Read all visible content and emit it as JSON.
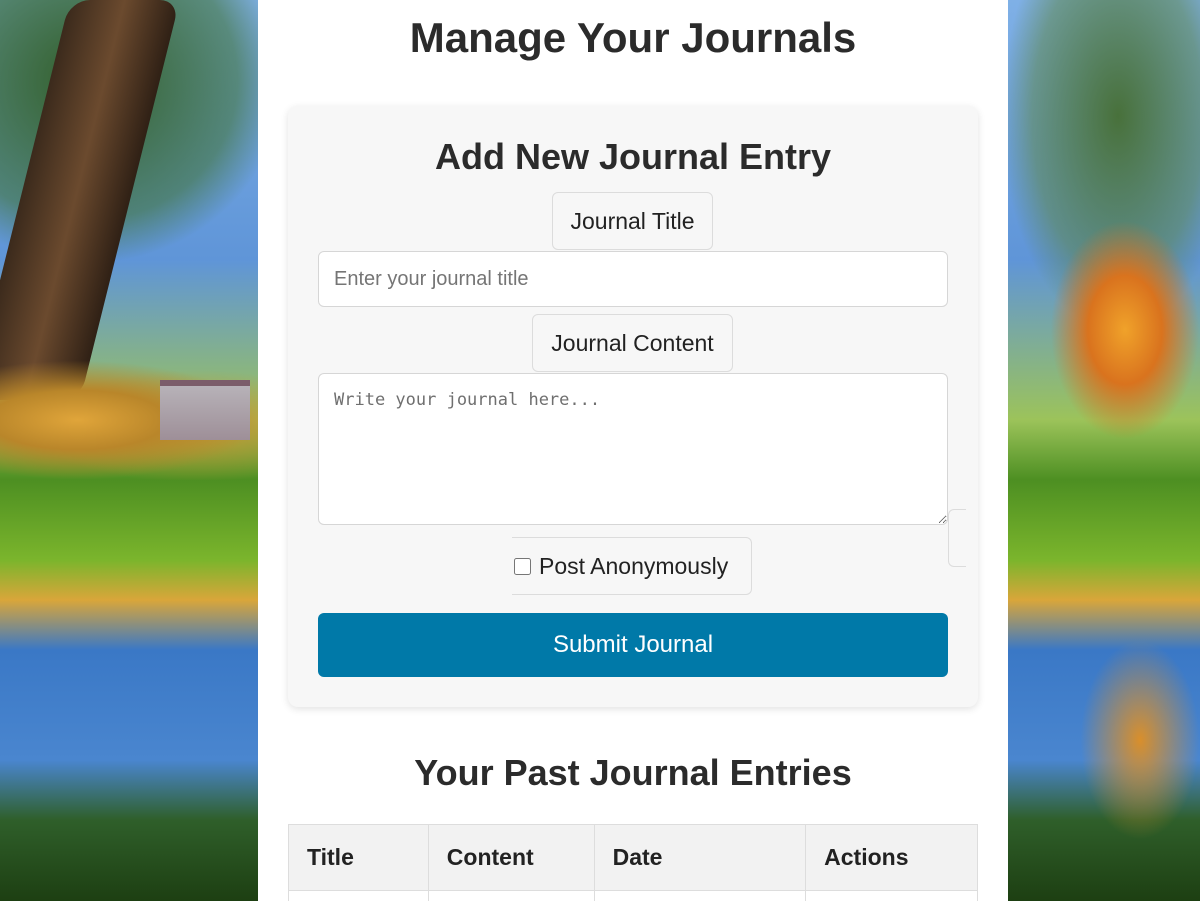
{
  "header": {
    "title": "Manage Your Journals"
  },
  "form": {
    "title": "Add New Journal Entry",
    "journal_title_label": "Journal Title",
    "journal_title_placeholder": "Enter your journal title",
    "journal_title_value": "",
    "journal_content_label": "Journal Content",
    "journal_content_placeholder": "Write your journal here...",
    "journal_content_value": "",
    "anonymous_label": "Post Anonymously",
    "anonymous_checked": false,
    "submit_label": "Submit Journal"
  },
  "entries": {
    "title": "Your Past Journal Entries",
    "columns": [
      "Title",
      "Content",
      "Date",
      "Actions"
    ],
    "rows": []
  },
  "colors": {
    "accent": "#0079a8",
    "card_bg": "#f7f7f7",
    "page_bg": "#ffffff",
    "text": "#2b2b2b"
  }
}
